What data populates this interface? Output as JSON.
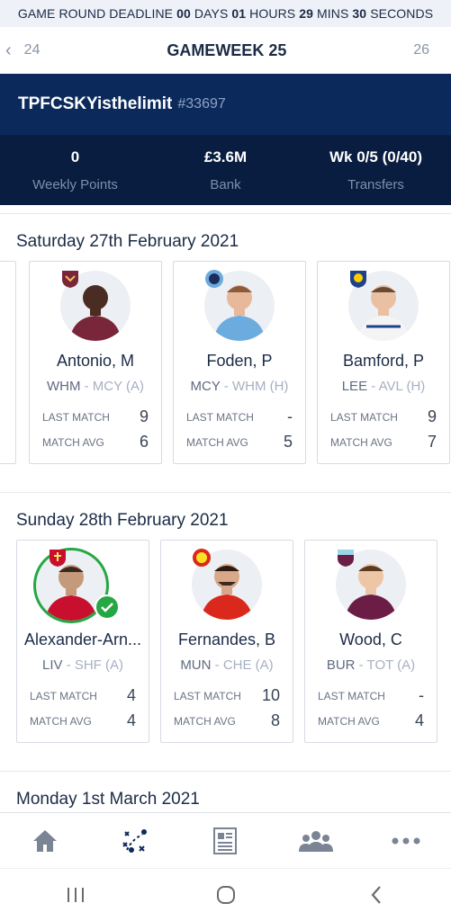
{
  "deadline": {
    "prefix": "GAME ROUND DEADLINE",
    "days": "00",
    "days_label": "DAYS",
    "hours": "01",
    "hours_label": "HOURS",
    "mins": "29",
    "mins_label": "MINS",
    "secs": "30",
    "secs_label": "SECONDS"
  },
  "gameweek": {
    "prev": "24",
    "title": "GAMEWEEK 25",
    "next": "26"
  },
  "team": {
    "name": "TPFCSKYisthelimit",
    "id": "#33697"
  },
  "stats": [
    {
      "value": "0",
      "label": "Weekly Points"
    },
    {
      "value": "£3.6M",
      "label": "Bank"
    },
    {
      "value": "Wk 0/5 (0/40)",
      "label": "Transfers"
    }
  ],
  "days": [
    {
      "title": "Saturday 27th February 2021",
      "cards": [
        {
          "name": "Antonio, M",
          "team": "WHM",
          "opp": "MCY (A)",
          "last_label": "LAST MATCH",
          "last": "9",
          "avg_label": "MATCH AVG",
          "avg": "6",
          "badge": "west-ham-badge",
          "shirt": "#7a263a"
        },
        {
          "name": "Foden, P",
          "team": "MCY",
          "opp": "WHM (H)",
          "last_label": "LAST MATCH",
          "last": "-",
          "avg_label": "MATCH AVG",
          "avg": "5",
          "badge": "man-city-badge",
          "shirt": "#6cabdd"
        },
        {
          "name": "Bamford, P",
          "team": "LEE",
          "opp": "AVL (H)",
          "last_label": "LAST MATCH",
          "last": "9",
          "avg_label": "MATCH AVG",
          "avg": "7",
          "badge": "leeds-badge",
          "shirt": "#ffffff"
        }
      ]
    },
    {
      "title": "Sunday 28th February 2021",
      "cards": [
        {
          "name": "Alexander-Arn...",
          "team": "LIV",
          "opp": "SHF (A)",
          "last_label": "LAST MATCH",
          "last": "4",
          "avg_label": "MATCH AVG",
          "avg": "4",
          "badge": "liverpool-badge",
          "shirt": "#c8102e",
          "selected": true
        },
        {
          "name": "Fernandes, B",
          "team": "MUN",
          "opp": "CHE (A)",
          "last_label": "LAST MATCH",
          "last": "10",
          "avg_label": "MATCH AVG",
          "avg": "8",
          "badge": "man-utd-badge",
          "shirt": "#da291c"
        },
        {
          "name": "Wood, C",
          "team": "BUR",
          "opp": "TOT (A)",
          "last_label": "LAST MATCH",
          "last": "-",
          "avg_label": "MATCH AVG",
          "avg": "4",
          "badge": "burnley-badge",
          "shirt": "#6c1d45"
        }
      ]
    },
    {
      "title": "Monday 1st March 2021",
      "cards": []
    }
  ],
  "colors": {
    "navy": "#0b2a5b",
    "navy_dark": "#081d3f",
    "green": "#25a744"
  }
}
